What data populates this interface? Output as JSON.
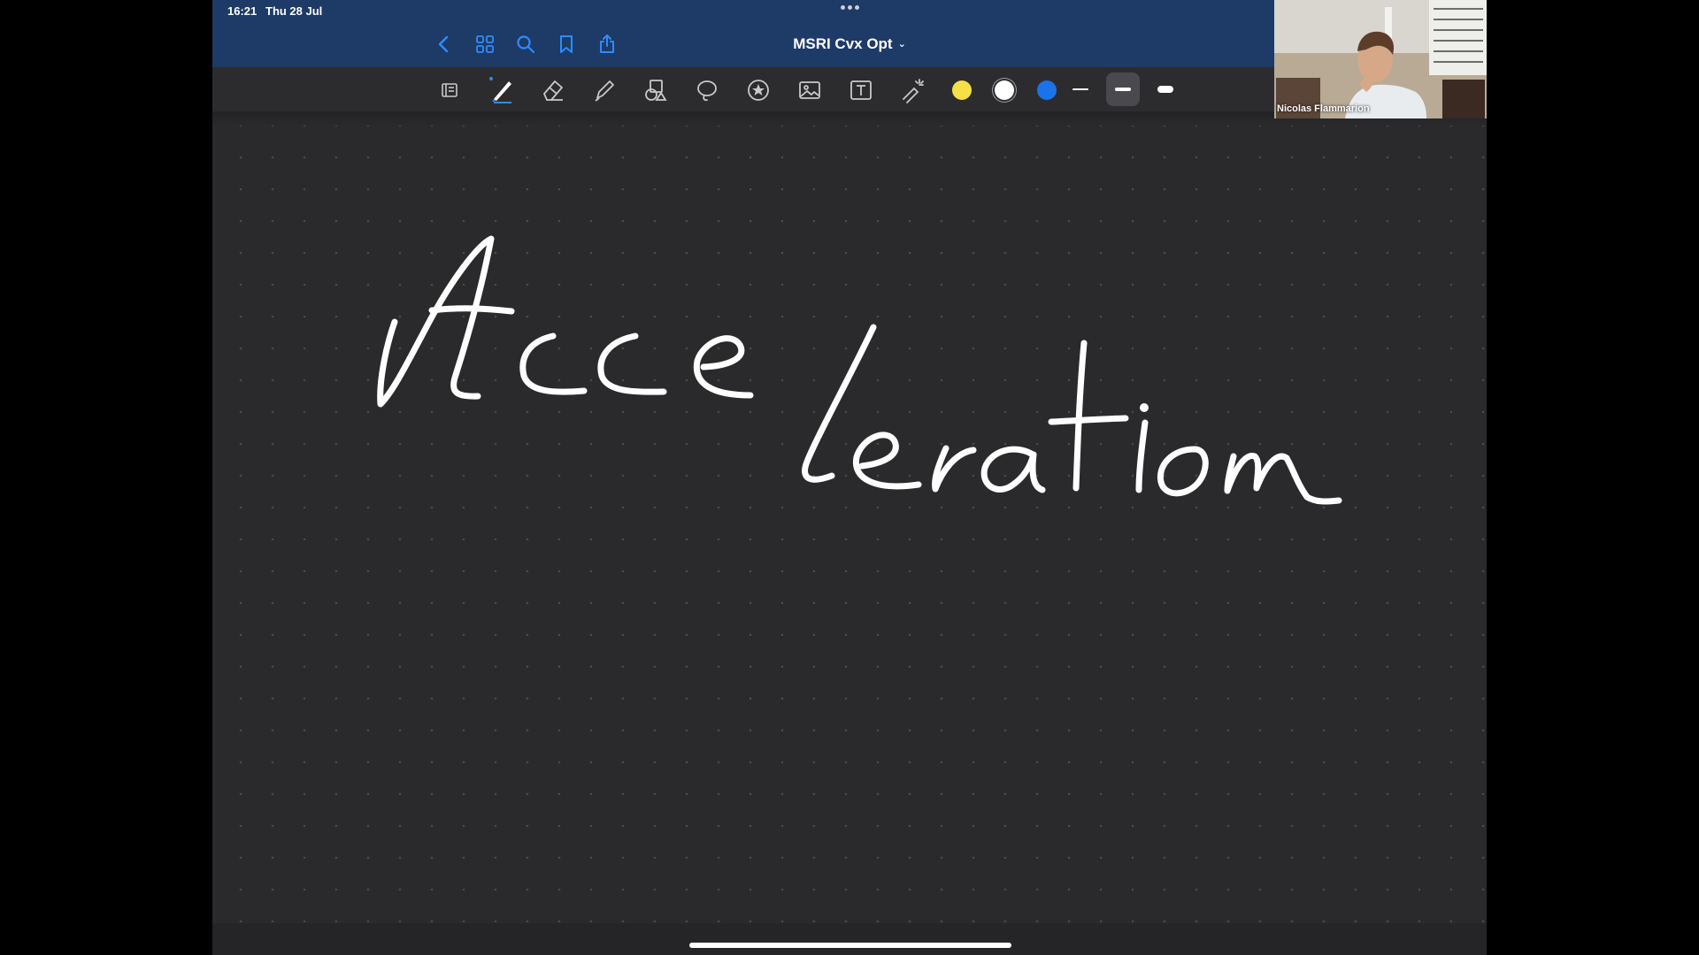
{
  "status": {
    "time": "16:21",
    "date": "Thu 28 Jul"
  },
  "nav": {
    "title": "MSRI Cvx Opt",
    "icons": [
      "back-icon",
      "grid-icon",
      "search-icon",
      "bookmark-icon",
      "share-icon"
    ]
  },
  "toolbar": {
    "tools": [
      "page-tool-icon",
      "pen-icon",
      "eraser-icon",
      "highlighter-icon",
      "shapes-icon",
      "lasso-icon",
      "sticker-icon",
      "image-icon",
      "text-box-icon",
      "laser-pointer-icon"
    ],
    "selected_tool": "pen",
    "colors": [
      "#f5e04a",
      "#ffffff",
      "#1a73e8"
    ],
    "selected_color": "#ffffff",
    "stroke_widths": [
      "thin",
      "medium",
      "thick"
    ],
    "selected_stroke": "medium"
  },
  "canvas": {
    "handwriting": "Acceleration",
    "ink_color": "#ffffff"
  },
  "video": {
    "participant_name": "Nicolas Flammarion"
  }
}
